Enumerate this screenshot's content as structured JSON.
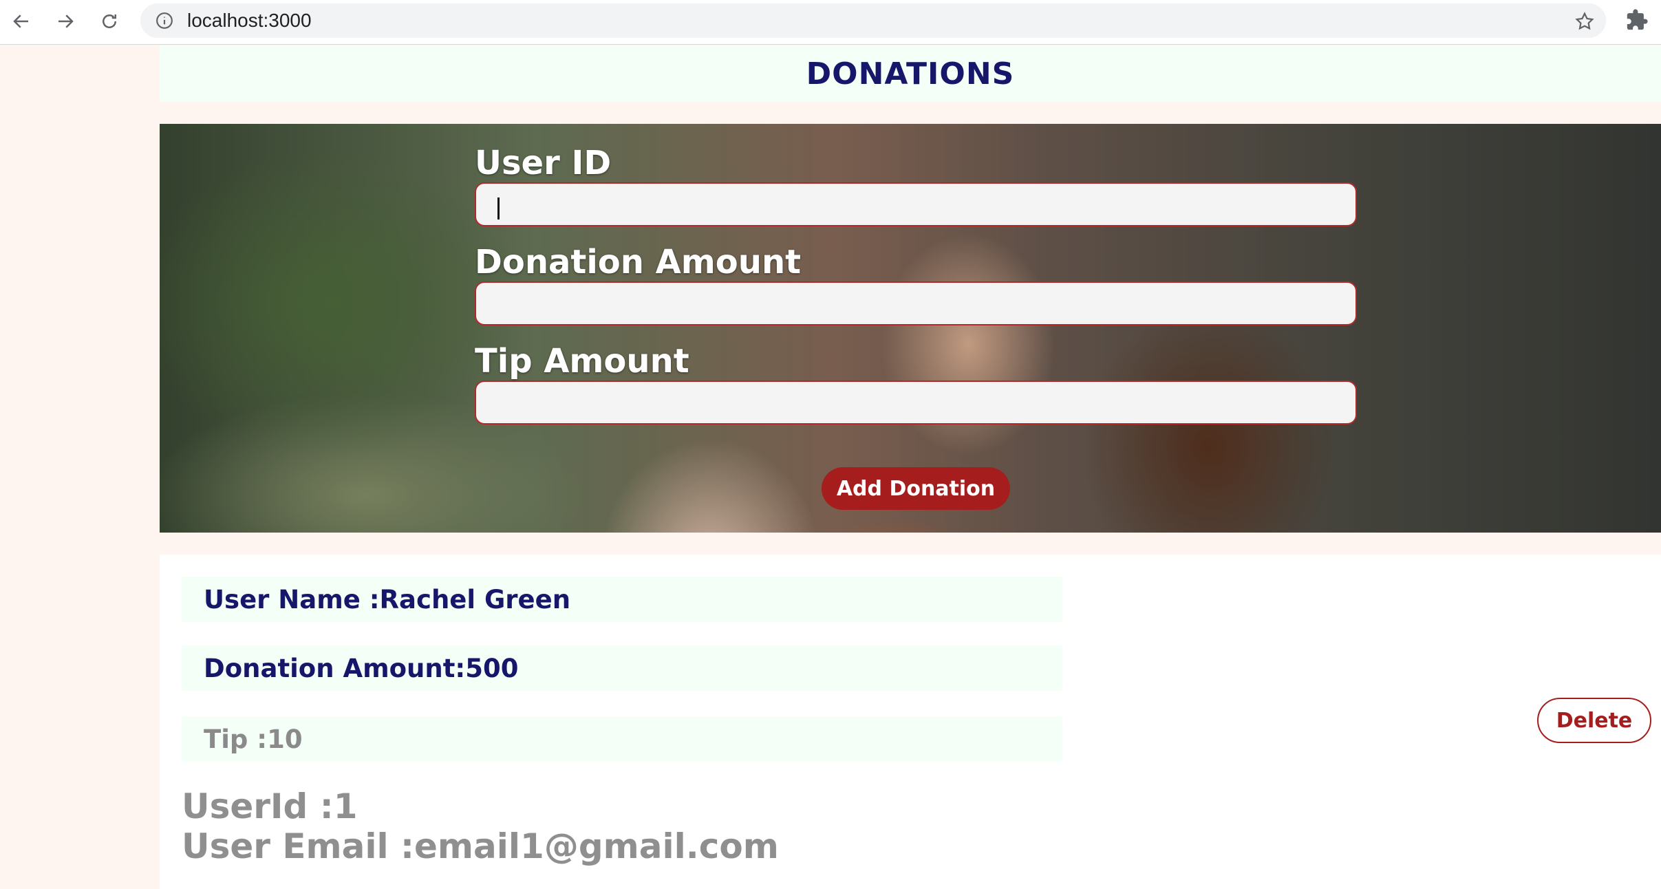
{
  "browser": {
    "url": "localhost:3000"
  },
  "header": {
    "title": "DONATIONS"
  },
  "form": {
    "user_id_label": "User ID",
    "user_id_value": "",
    "donation_amount_label": "Donation Amount",
    "donation_amount_value": "",
    "tip_amount_label": "Tip Amount",
    "tip_amount_value": "",
    "submit_label": "Add Donation"
  },
  "donation": {
    "user_name": "User Name :Rachel Green",
    "donation_amount": "Donation Amount:500",
    "tip": "Tip :10",
    "user_id": "UserId :1",
    "user_email": "User Email :email1@gmail.com",
    "delete_label": "Delete"
  },
  "icons": {
    "back": "back-arrow-icon",
    "forward": "forward-arrow-icon",
    "reload": "reload-icon",
    "site_info": "info-icon",
    "bookmark": "star-icon",
    "extensions": "puzzle-icon"
  },
  "colors": {
    "accent_red": "#a61d1d",
    "title_navy": "#16176b",
    "page_bg": "#fff5f0",
    "row_bg": "#f4fff8"
  }
}
